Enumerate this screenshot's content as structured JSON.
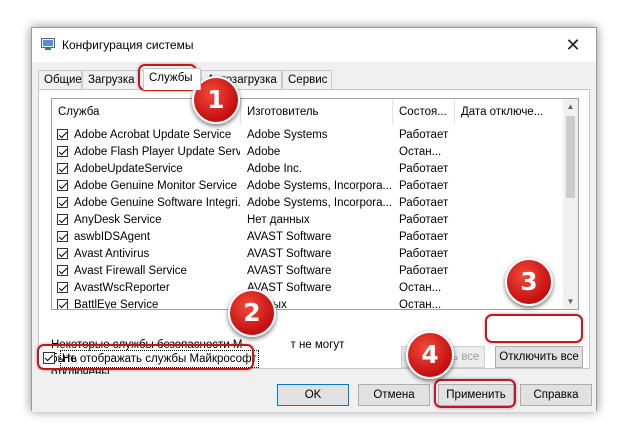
{
  "window": {
    "title": "Конфигурация системы",
    "close_glyph": "✕",
    "app_icon": "msconfig-icon"
  },
  "tabs": [
    "Общие",
    "Загрузка",
    "Службы",
    "Автозагрузка",
    "Сервис"
  ],
  "active_tab": "Службы",
  "columns": [
    "Служба",
    "Изготовитель",
    "Состоя...",
    "Дата отключе..."
  ],
  "services": [
    {
      "name": "Adobe Acrobat Update Service",
      "vendor": "Adobe Systems",
      "status": "Работает",
      "checked": true
    },
    {
      "name": "Adobe Flash Player Update Service",
      "vendor": "Adobe",
      "status": "Остан...",
      "checked": true
    },
    {
      "name": "AdobeUpdateService",
      "vendor": "Adobe Inc.",
      "status": "Работает",
      "checked": true
    },
    {
      "name": "Adobe Genuine Monitor Service",
      "vendor": "Adobe Systems, Incorpora...",
      "status": "Работает",
      "checked": true
    },
    {
      "name": "Adobe Genuine Software Integri...",
      "vendor": "Adobe Systems, Incorpora...",
      "status": "Работает",
      "checked": true
    },
    {
      "name": "AnyDesk Service",
      "vendor": "Нет данных",
      "status": "Работает",
      "checked": true
    },
    {
      "name": "aswbIDSAgent",
      "vendor": "AVAST Software",
      "status": "Работает",
      "checked": true
    },
    {
      "name": "Avast Antivirus",
      "vendor": "AVAST Software",
      "status": "Работает",
      "checked": true
    },
    {
      "name": "Avast Firewall Service",
      "vendor": "AVAST Software",
      "status": "Работает",
      "checked": true
    },
    {
      "name": "AvastWscReporter",
      "vendor": "AVAST Software",
      "status": "Остан...",
      "checked": true
    },
    {
      "name": "BattlEye Service",
      "vendor": "данных",
      "status": "Остан...",
      "checked": true
    }
  ],
  "note": {
    "line1_a": "Некоторые службы безопасности М",
    "line1_b": "т не могут быть",
    "line2": "отключены."
  },
  "buttons": {
    "enable_all": "Включить все",
    "disable_all": "Отключить все",
    "ok": "OK",
    "cancel": "Отмена",
    "apply": "Применить",
    "help": "Справка"
  },
  "hide_ms": {
    "label": "Не отображать службы Майкрософт",
    "checked": true
  },
  "markers": [
    "1",
    "2",
    "3",
    "4"
  ],
  "colors": {
    "highlight": "#c0181f",
    "marker": "#d4171a"
  }
}
